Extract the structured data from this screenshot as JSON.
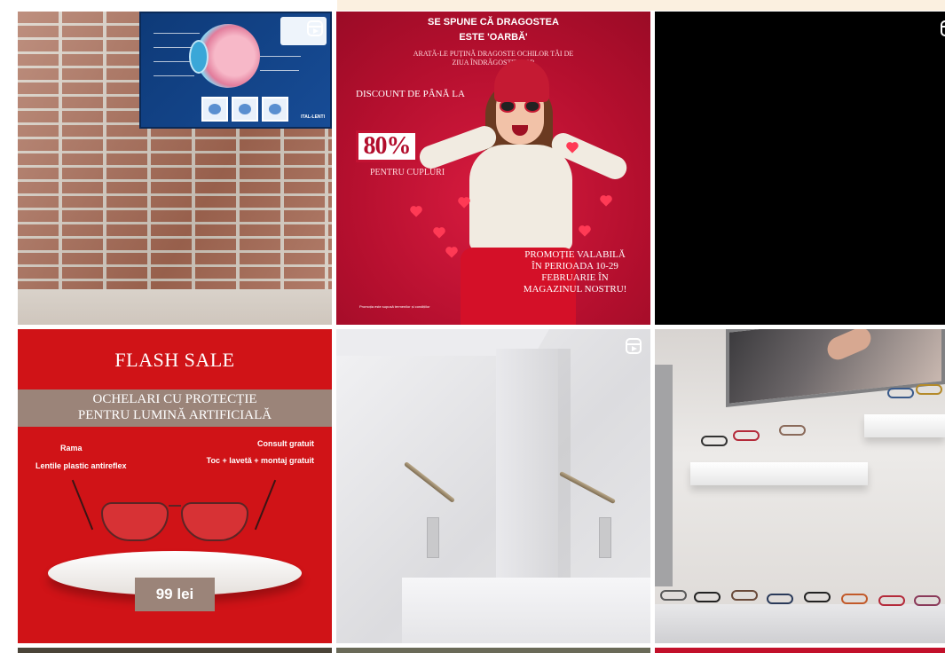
{
  "grid": {
    "posts": [
      {
        "id": "eye-poster",
        "type": "reel",
        "poster_brand": "ITAL-LENTI"
      },
      {
        "id": "valentine-promo",
        "type": "post",
        "headline_1": "SE SPUNE CĂ DRAGOSTEA",
        "headline_2": "ESTE 'OARBĂ'",
        "subhead_1": "ARATĂ-LE PUȚINĂ DRAGOSTE OCHILOR TĂI DE",
        "subhead_2": "ZIUA ÎNDRĂGOSTIȚILOR",
        "discount_label": "DISCOUNT DE PÂNĂ LA",
        "discount_value": "80%",
        "couples": "PENTRU CUPLURI",
        "promo_1": "PROMOȚIE VALABILĂ",
        "promo_2": "ÎN PERIOADA 10-29",
        "promo_3": "FEBRUARIE ÎN",
        "promo_4": "MAGAZINUL NOSTRU!",
        "fine_print": "Promoția este supusă termenilor și condițiilor"
      },
      {
        "id": "black-reel",
        "type": "reel"
      },
      {
        "id": "flash-sale",
        "type": "post",
        "title": "FLASH SALE",
        "band_line_1": "OCHELARI CU PROTECȚIE",
        "band_line_2": "PENTRU LUMINĂ ARTIFICIALĂ",
        "feature_left_1": "Rama",
        "feature_left_2": "Lentile plastic antireflex",
        "feature_right_1": "Consult gratuit",
        "feature_right_2": "Toc + lavetă + montaj gratuit",
        "price": "99 lei"
      },
      {
        "id": "white-display",
        "type": "reel"
      },
      {
        "id": "store-shelves",
        "type": "reel"
      }
    ]
  },
  "colors": {
    "valentine_red": "#c0122f",
    "flash_red": "#d01317",
    "band_taupe": "#9b8479",
    "poster_blue": "#134487"
  },
  "icons": {
    "reel": "reel-icon"
  }
}
